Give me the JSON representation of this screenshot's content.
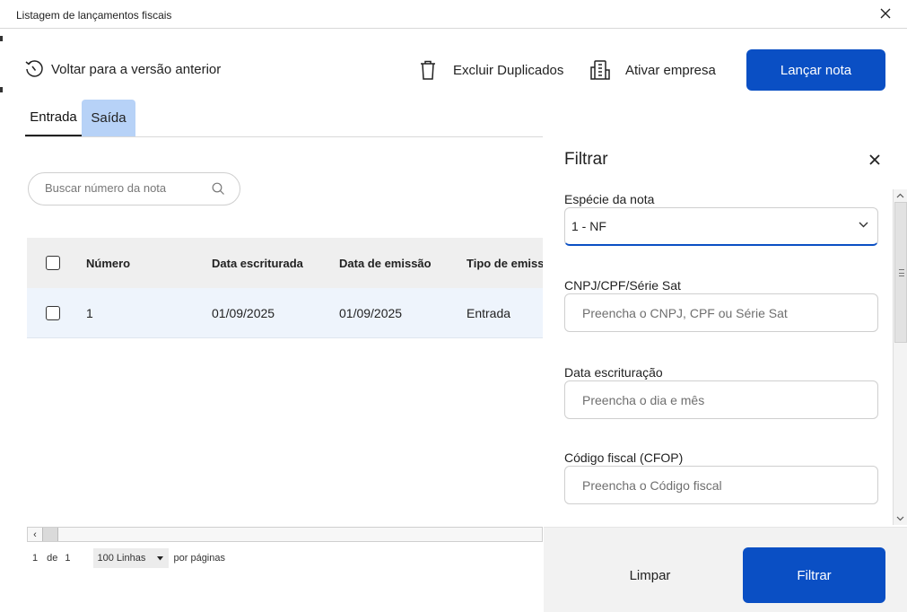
{
  "window": {
    "title": "Listagem de lançamentos fiscais"
  },
  "toolbar": {
    "back_label": "Voltar para a versão anterior",
    "delete_duplicates_label": "Excluir Duplicados",
    "activate_company_label": "Ativar empresa",
    "launch_note_label": "Lançar nota"
  },
  "tabs": [
    {
      "label": "Entrada",
      "active": true
    },
    {
      "label": "Saída",
      "active": false
    }
  ],
  "search": {
    "placeholder": "Buscar número da nota"
  },
  "table": {
    "columns": [
      "Número",
      "Data escriturada",
      "Data de emissão",
      "Tipo de emiss"
    ],
    "rows": [
      {
        "numero": "1",
        "data_escriturada": "01/09/2025",
        "data_emissao": "01/09/2025",
        "tipo_emissao": "Entrada"
      }
    ]
  },
  "pagination": {
    "current": "1",
    "of_label": "de",
    "total": "1",
    "rows_per_page": "100 Linhas",
    "per_page_label": "por páginas"
  },
  "filter_panel": {
    "title": "Filtrar",
    "fields": {
      "especie": {
        "label": "Espécie da nota",
        "value": "1 - NF"
      },
      "cnpj": {
        "label": "CNPJ/CPF/Série Sat",
        "placeholder": "Preencha o CNPJ, CPF ou Série Sat"
      },
      "data_escrituracao": {
        "label": "Data escrituração",
        "placeholder": "Preencha o dia e mês"
      },
      "cfop": {
        "label": "Código fiscal (CFOP)",
        "placeholder": "Preencha o Código fiscal"
      }
    },
    "clear_label": "Limpar",
    "filter_label": "Filtrar"
  },
  "colors": {
    "primary": "#0a4fc4",
    "tab_hover": "#b7d2f7",
    "row_highlight": "#eef4fc"
  }
}
